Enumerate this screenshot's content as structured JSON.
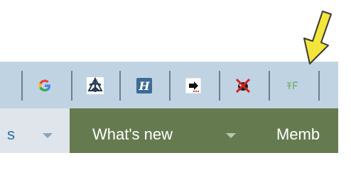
{
  "toolbar": {
    "background": "#bfd3e3",
    "extensions": [
      {
        "icon": "google-g-icon"
      },
      {
        "icon": "ship-wheel-icon"
      },
      {
        "icon": "h-square-icon"
      },
      {
        "icon": "arrow-download-icon"
      },
      {
        "icon": "no-bug-icon"
      },
      {
        "icon": "grid-f-icon"
      }
    ]
  },
  "annotation": {
    "arrow_color": "#f4e53a",
    "arrow_outline": "#3a3a3a"
  },
  "nav": {
    "left_label": "s",
    "whats_new_label": "What's new",
    "members_label": "Memb",
    "main_background": "#657b4f",
    "left_background": "#dfe5ea"
  }
}
